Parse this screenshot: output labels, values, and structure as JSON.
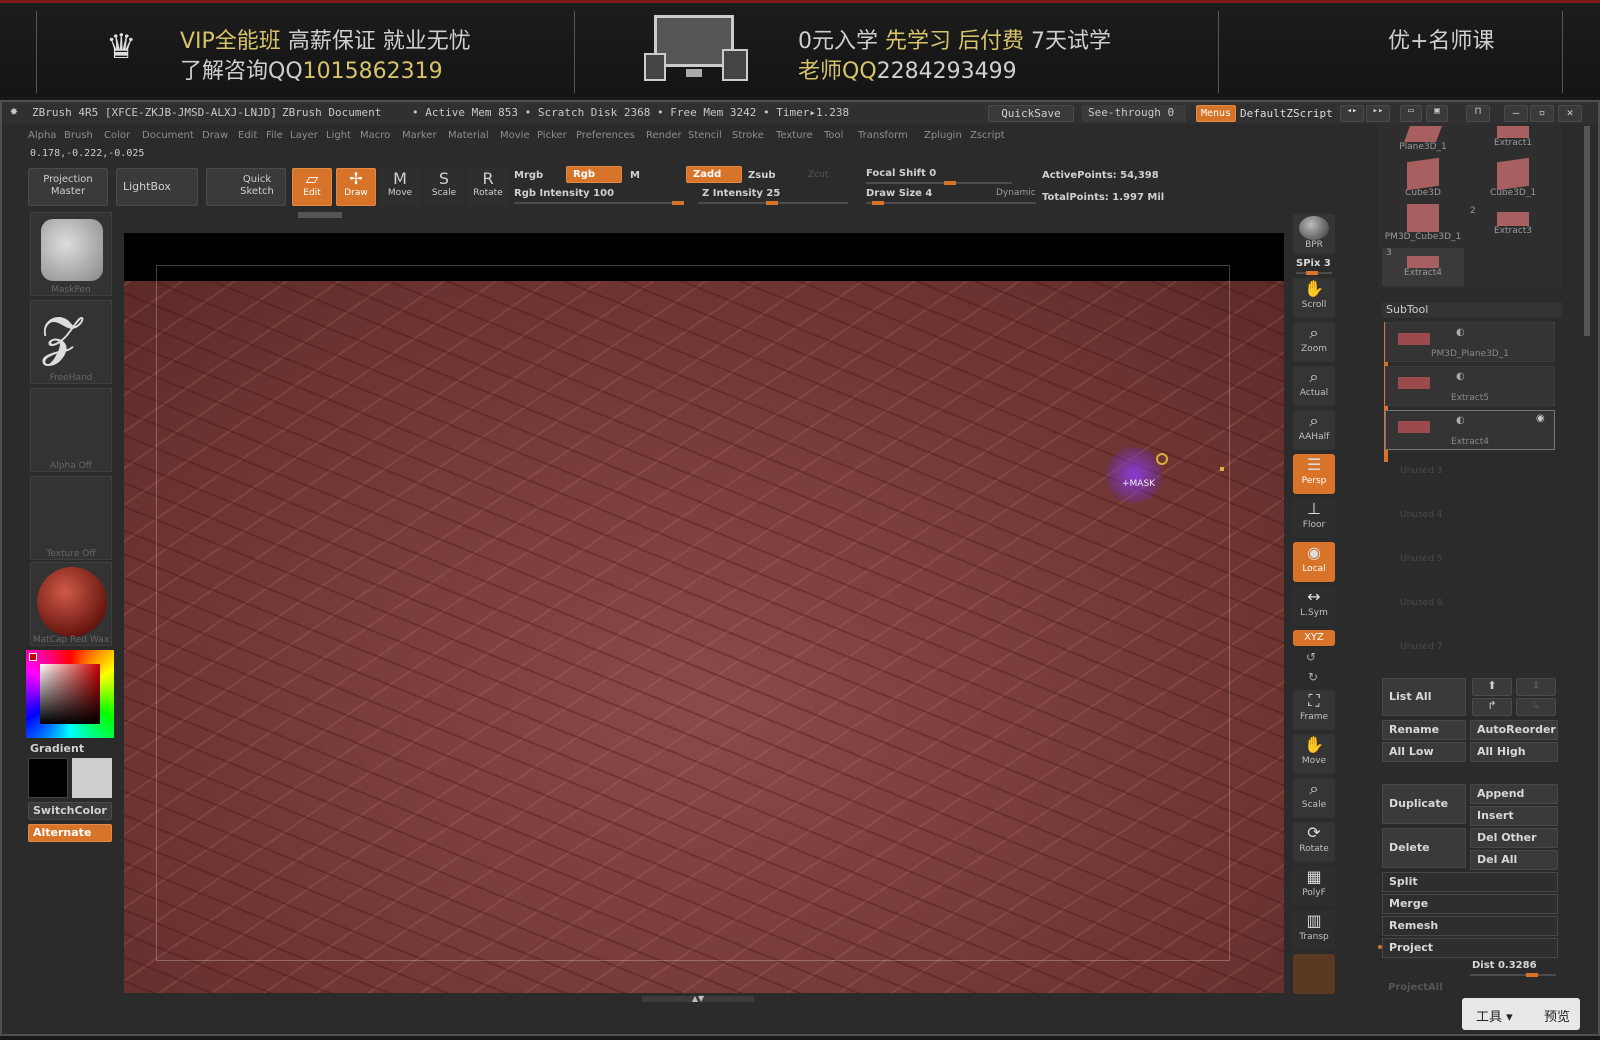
{
  "banner": {
    "line1a": "VIP全能班",
    "line1b": "高薪保证  就业无忧",
    "line2a": "了解咨询QQ",
    "line2b": "1015862319",
    "mid1a": "0元入学",
    "mid1b": "先学习",
    "mid1c": "后付费",
    "mid1d": "7天试学",
    "mid2a": "老师QQ",
    "mid2b": "2284293499",
    "right": "优+名师课",
    "icons": [
      "crown-icon",
      "monitor-devices-icon"
    ]
  },
  "title": {
    "app": "ZBrush 4R5 [XFCE-ZKJB-JMSD-ALXJ-LNJD]",
    "doc": "ZBrush Document",
    "mem": "• Active Mem 853 • Scratch Disk 2368 • Free Mem 3242 • Timer▸1.238",
    "quicksave": "QuickSave",
    "seethrough": "See-through   0",
    "menus": "Menus",
    "script": "DefaultZScript"
  },
  "menu": [
    "Alpha",
    "Brush",
    "Color",
    "Document",
    "Draw",
    "Edit",
    "File",
    "Layer",
    "Light",
    "Macro",
    "Marker",
    "Material",
    "Movie",
    "Picker",
    "Preferences",
    "Render",
    "Stencil",
    "Stroke",
    "Texture",
    "Tool",
    "Transform",
    "Zplugin",
    "Zscript"
  ],
  "coords": "0.178,-0.222,-0.025",
  "toolbar": {
    "projection": "Projection\nMaster",
    "lightbox": "LightBox",
    "quick": "Quick\nSketch",
    "edit": "Edit",
    "draw": "Draw",
    "move": "Move",
    "scale": "Scale",
    "rotate": "Rotate",
    "mrgb": "Mrgb",
    "rgb": "Rgb",
    "m": "M",
    "rgbint": "Rgb Intensity 100",
    "zadd": "Zadd",
    "zsub": "Zsub",
    "zcut": "Zcut",
    "zint": "Z Intensity 25",
    "focal": "Focal Shift 0",
    "drawsize": "Draw Size 4",
    "dynamic": "Dynamic",
    "active": "ActivePoints: 54,398",
    "total": "TotalPoints: 1.997 Mil"
  },
  "left": {
    "maskpen": "MaskPen",
    "freehand": "FreeHand",
    "alpha": "Alpha  Off",
    "texture": "Texture  Off",
    "matcap": "MatCap Red Wax",
    "gradient": "Gradient",
    "switch": "SwitchColor",
    "alternate": "Alternate"
  },
  "right": {
    "bpr": "BPR",
    "spix": "SPix 3",
    "scroll": "Scroll",
    "zoom": "Zoom",
    "actual": "Actual",
    "aahalf": "AAHalf",
    "persp": "Persp",
    "floor": "Floor",
    "local": "Local",
    "lsym": "L.Sym",
    "xyz": "XYZ",
    "frame": "Frame",
    "move": "Move",
    "scale": "Scale",
    "rotate": "Rotate",
    "polyf": "PolyF",
    "transp": "Transp"
  },
  "cursor": "+MASK",
  "tools": [
    {
      "name": "Plane3D_1"
    },
    {
      "name": "Extract1"
    },
    {
      "name": "Cube3D"
    },
    {
      "name": "Cube3D_1"
    },
    {
      "name": "PM3D_Cube3D_1"
    },
    {
      "name": "Extract3"
    },
    {
      "name": "Extract4"
    }
  ],
  "tool_counts": [
    "2",
    "3"
  ],
  "subtool": {
    "header": "SubTool",
    "items": [
      "PM3D_Plane3D_1",
      "Extract5",
      "Extract4"
    ],
    "unused": [
      "Unused 3",
      "Unused 4",
      "Unused 5",
      "Unused 6",
      "Unused 7"
    ]
  },
  "subbtns": {
    "listall": "List All",
    "rename": "Rename",
    "autoreorder": "AutoReorder",
    "alllow": "All Low",
    "allhigh": "All High",
    "duplicate": "Duplicate",
    "append": "Append",
    "insert": "Insert",
    "delete": "Delete",
    "delother": "Del Other",
    "delall": "Del All",
    "split": "Split",
    "merge": "Merge",
    "remesh": "Remesh",
    "project": "Project",
    "dist": "Dist 0.3286",
    "projectall": "ProjectAll"
  },
  "corner": {
    "tool": "工具 ▾",
    "preview": "预览"
  }
}
